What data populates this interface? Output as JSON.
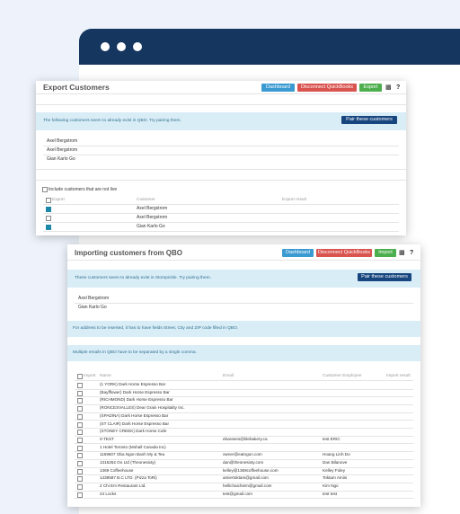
{
  "export_panel": {
    "title": "Export Customers",
    "buttons": {
      "dashboard": "Dashboard",
      "disconnect": "Disconnect QuickBooks",
      "export": "Export"
    },
    "info_text": "The following customers seem to already exist in QBO. Try pairing them.",
    "pair_button": "Pair these customers",
    "existing_customers": [
      "Axel Bergstrom",
      "Axel Bergstrom",
      "Gian Karlo Go"
    ],
    "include_label": "Include customers that are not live",
    "table_headers": {
      "export": "Export",
      "customer": "Customer",
      "result": "Export result"
    },
    "rows": [
      {
        "checked": true,
        "name": "Axel Bergstrom"
      },
      {
        "checked": false,
        "name": "Axel Bergstrom"
      },
      {
        "checked": true,
        "name": "Gian Karlo Go"
      }
    ]
  },
  "import_panel": {
    "title": "Importing customers from QBO",
    "buttons": {
      "dashboard": "Dashboard",
      "disconnect": "Disconnect QuickBooks",
      "import": "Import"
    },
    "info_text": "These customers seem to already exist in Storepickle. Try pairing them.",
    "pair_button": "Pair these customers",
    "existing_customers": [
      "Axel Bergstrom",
      "Gian Karlo Go"
    ],
    "address_note": "For address to be inserted, it has to have fields Street, City and ZIP code filled in QBO.",
    "email_note": "Multiple emails in QBO have to be separated by a single comma.",
    "table_headers": {
      "import": "Import",
      "name": "Name",
      "email": "Email",
      "employee": "Customer Employee",
      "result": "Import result"
    },
    "rows": [
      {
        "name": "(1 YORK) Dark Horse Espresso Bar",
        "email": "",
        "employee": ""
      },
      {
        "name": "(Bayfflower) Dark Horse Espresso Bar",
        "email": "",
        "employee": ""
      },
      {
        "name": "(RICHMOND) Dark Horse Espresso Bar",
        "email": "",
        "employee": ""
      },
      {
        "name": "(RONCESVALLES) Dear Grain Hospitality Inc.",
        "email": "",
        "employee": ""
      },
      {
        "name": "(SPADINA) Dark Horse Espresso Bar",
        "email": "",
        "employee": ""
      },
      {
        "name": "(ST CLAIR) Dark Horse Espresso Bar",
        "email": "",
        "employee": ""
      },
      {
        "name": "(STONEY CREEK) Dark Horse Cafe",
        "email": "",
        "employee": ""
      },
      {
        "name": "0-TEST",
        "email": "ebaranes@blebakery.ca",
        "employee": "test ERIC"
      },
      {
        "name": "1 Hotel Toronto (Mohall Canada Inc)",
        "email": "",
        "employee": ""
      },
      {
        "name": "1169607 Oba Ngon Banh My & Tea",
        "email": "owner@eatngon.com",
        "employee": "Hoang Linh Do"
      },
      {
        "name": "1316252 Oo Ltd (Theonesixty)",
        "email": "dan@theonesixty.com",
        "employee": "Dan Bilanove"
      },
      {
        "name": "1369 Coffeehouse",
        "email": "kelley@1369coffeehouse.com",
        "employee": "Kelley Foley"
      },
      {
        "name": "1439587 B.C LTD. (Pizza ToRi)",
        "email": "amiertoktam@gmail.com",
        "employee": "Toktam Amini"
      },
      {
        "name": "2 Chi Em Restaurant Ltd.",
        "email": "hellichaichiem@gmail.com",
        "employee": "Kim Ngo"
      },
      {
        "name": "24 Locks",
        "email": "test@gmail.com",
        "employee": "test test"
      }
    ]
  }
}
